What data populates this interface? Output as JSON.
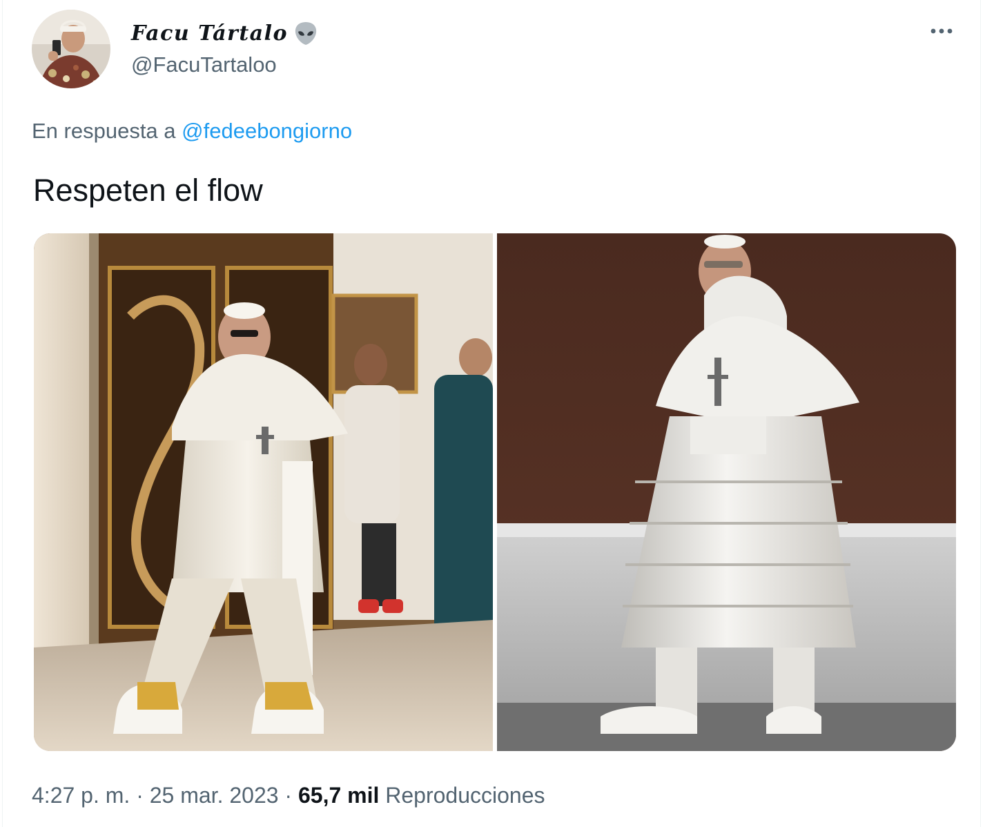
{
  "author": {
    "display_name": "Facu Tártalo",
    "emoji_icon": "alien-icon",
    "handle": "@FacuTartaloo"
  },
  "reply": {
    "prefix": "En respuesta a",
    "mention": "@fedeebongiorno"
  },
  "tweet": {
    "text": "Respeten el flow"
  },
  "media": {
    "count": 2,
    "items": [
      {
        "description_icon": "photo-pope-sneakers"
      },
      {
        "description_icon": "photo-pope-puffer-coat"
      }
    ]
  },
  "meta": {
    "time": "4:27 p. m.",
    "separator": "·",
    "date": "25 mar. 2023",
    "views_count": "65,7 mil",
    "views_label": "Reproducciones"
  },
  "colors": {
    "link": "#1d9bf0",
    "secondary_text": "#536471",
    "primary_text": "#0f1419"
  }
}
